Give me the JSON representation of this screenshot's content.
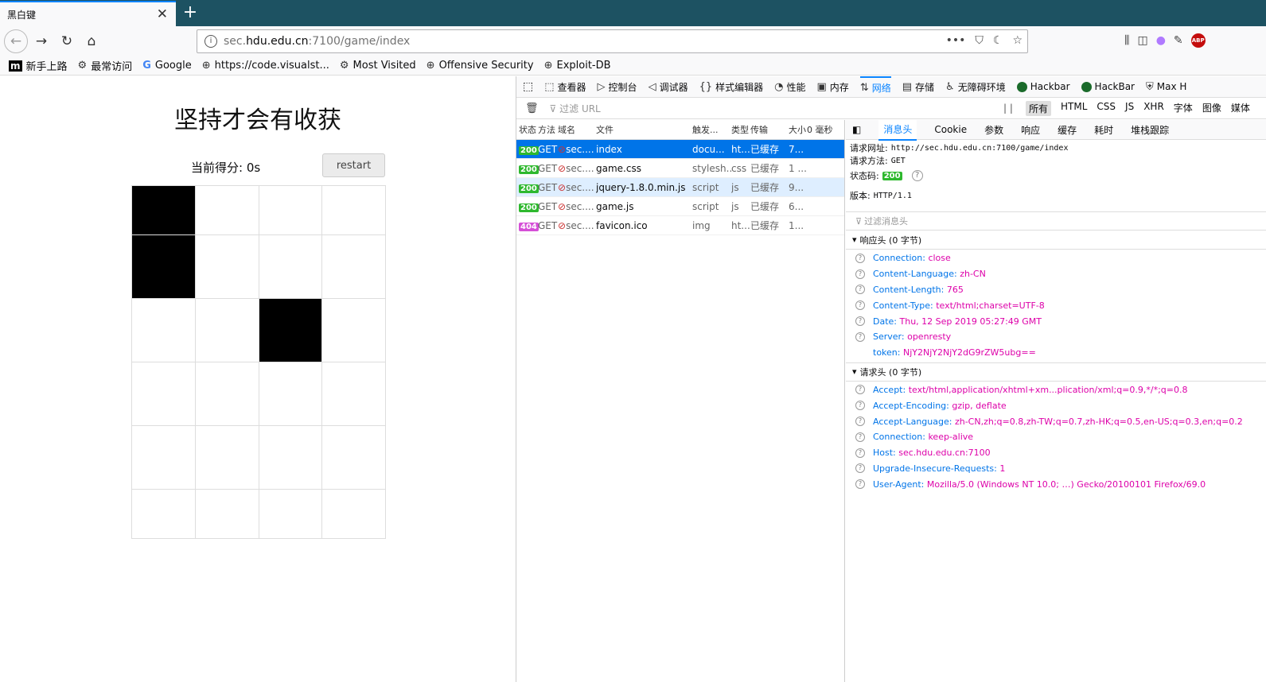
{
  "browser": {
    "tab_title": "黑白键",
    "close_glyph": "✕",
    "newtab_glyph": "+",
    "url_prefix": "sec.",
    "url_domain": "hdu.edu.cn",
    "url_suffix": ":7100/game/index"
  },
  "bookmarks": [
    {
      "label": "新手上路",
      "icon": "m-icon"
    },
    {
      "label": "最常访问",
      "icon": "gear-icon"
    },
    {
      "label": "Google",
      "icon": "google-icon"
    },
    {
      "label": "https://code.visualst...",
      "icon": "globe-icon"
    },
    {
      "label": "Most Visited",
      "icon": "gear-icon"
    },
    {
      "label": "Offensive Security",
      "icon": "globe-icon"
    },
    {
      "label": "Exploit-DB",
      "icon": "globe-icon"
    }
  ],
  "game": {
    "title": "坚持才会有收获",
    "score_label": "当前得分: 0s",
    "restart_label": "restart",
    "rows": [
      [
        1,
        0,
        0,
        0
      ],
      [
        1,
        0,
        0,
        0
      ],
      [
        0,
        0,
        1,
        0
      ],
      [
        0,
        0,
        0,
        0
      ],
      [
        0,
        0,
        0,
        0
      ],
      [
        0,
        0,
        0,
        0
      ]
    ]
  },
  "devtools": {
    "tabs": [
      {
        "label": "查看器",
        "icon": "inspector-icon"
      },
      {
        "label": "控制台",
        "icon": "console-icon"
      },
      {
        "label": "调试器",
        "icon": "debugger-icon"
      },
      {
        "label": "样式编辑器",
        "icon": "braces-icon"
      },
      {
        "label": "性能",
        "icon": "gauge-icon"
      },
      {
        "label": "内存",
        "icon": "memory-icon"
      },
      {
        "label": "网络",
        "icon": "network-icon",
        "active": true
      },
      {
        "label": "存储",
        "icon": "storage-icon"
      },
      {
        "label": "无障碍环境",
        "icon": "accessibility-icon"
      },
      {
        "label": "Hackbar",
        "icon": "hackbar-icon"
      },
      {
        "label": "HackBar",
        "icon": "hackbar-icon"
      },
      {
        "label": "Max H",
        "icon": "maxh-icon"
      }
    ],
    "filter_placeholder": "过滤 URL",
    "pause_label": "| |",
    "type_filters": [
      "所有",
      "HTML",
      "CSS",
      "JS",
      "XHR",
      "字体",
      "图像",
      "媒体"
    ],
    "columns": [
      "状态",
      "方法",
      "域名",
      "文件",
      "触发...",
      "类型",
      "传输",
      "大小",
      "0 毫秒"
    ],
    "requests": [
      {
        "status": "200",
        "method": "GET",
        "domain": "sec....",
        "file": "index",
        "cause": "docu...",
        "type": "ht...",
        "transfer": "已缓存",
        "size": "7..."
      },
      {
        "status": "200",
        "method": "GET",
        "domain": "sec....",
        "file": "game.css",
        "cause": "stylesh...",
        "type": "css",
        "transfer": "已缓存",
        "size": "1 ..."
      },
      {
        "status": "200",
        "method": "GET",
        "domain": "sec....",
        "file": "jquery-1.8.0.min.js",
        "cause": "script",
        "type": "js",
        "transfer": "已缓存",
        "size": "9..."
      },
      {
        "status": "200",
        "method": "GET",
        "domain": "sec....",
        "file": "game.js",
        "cause": "script",
        "type": "js",
        "transfer": "已缓存",
        "size": "6..."
      },
      {
        "status": "404",
        "method": "GET",
        "domain": "sec....",
        "file": "favicon.ico",
        "cause": "img",
        "type": "ht...",
        "transfer": "已缓存",
        "size": "1..."
      }
    ],
    "detail_tabs": [
      "消息头",
      "Cookie",
      "参数",
      "响应",
      "缓存",
      "耗时",
      "堆栈跟踪"
    ],
    "summary": {
      "url_label": "请求网址:",
      "url_value": "http://sec.hdu.edu.cn:7100/game/index",
      "method_label": "请求方法:",
      "method_value": "GET",
      "status_label": "状态码:",
      "status_value": "200",
      "version_label": "版本:",
      "version_value": "HTTP/1.1"
    },
    "header_filter": "过滤消息头",
    "response_section": "响应头 (0 字节)",
    "response_headers": [
      {
        "name": "Connection:",
        "value": "close",
        "q": true
      },
      {
        "name": "Content-Language:",
        "value": "zh-CN",
        "q": true
      },
      {
        "name": "Content-Length:",
        "value": "765",
        "q": true
      },
      {
        "name": "Content-Type:",
        "value": "text/html;charset=UTF-8",
        "q": true
      },
      {
        "name": "Date:",
        "value": "Thu, 12 Sep 2019 05:27:49 GMT",
        "q": true
      },
      {
        "name": "Server:",
        "value": "openresty",
        "q": true
      },
      {
        "name": "token:",
        "value": "NjY2NjY2NjY2dG9rZW5ubg==",
        "q": false
      }
    ],
    "request_section": "请求头 (0 字节)",
    "request_headers": [
      {
        "name": "Accept:",
        "value": "text/html,application/xhtml+xm...plication/xml;q=0.9,*/*;q=0.8"
      },
      {
        "name": "Accept-Encoding:",
        "value": "gzip, deflate"
      },
      {
        "name": "Accept-Language:",
        "value": "zh-CN,zh;q=0.8,zh-TW;q=0.7,zh-HK;q=0.5,en-US;q=0.3,en;q=0.2"
      },
      {
        "name": "Connection:",
        "value": "keep-alive"
      },
      {
        "name": "Host:",
        "value": "sec.hdu.edu.cn:7100"
      },
      {
        "name": "Upgrade-Insecure-Requests:",
        "value": "1"
      },
      {
        "name": "User-Agent:",
        "value": "Mozilla/5.0 (Windows NT 10.0; …) Gecko/20100101 Firefox/69.0"
      }
    ]
  }
}
